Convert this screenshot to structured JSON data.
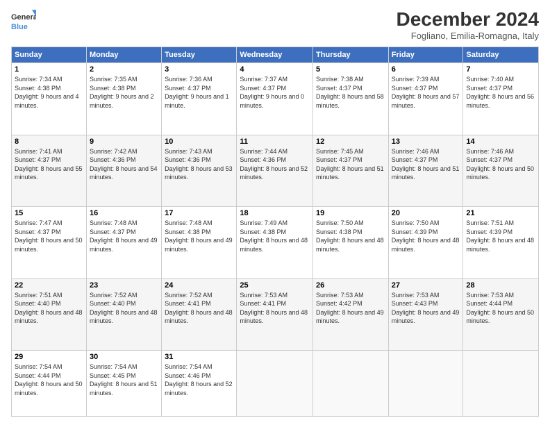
{
  "logo": {
    "line1": "General",
    "line2": "Blue"
  },
  "title": "December 2024",
  "subtitle": "Fogliano, Emilia-Romagna, Italy",
  "days_header": [
    "Sunday",
    "Monday",
    "Tuesday",
    "Wednesday",
    "Thursday",
    "Friday",
    "Saturday"
  ],
  "weeks": [
    [
      {
        "num": "1",
        "sunrise": "7:34 AM",
        "sunset": "4:38 PM",
        "daylight": "9 hours and 4 minutes."
      },
      {
        "num": "2",
        "sunrise": "7:35 AM",
        "sunset": "4:38 PM",
        "daylight": "9 hours and 2 minutes."
      },
      {
        "num": "3",
        "sunrise": "7:36 AM",
        "sunset": "4:37 PM",
        "daylight": "9 hours and 1 minute."
      },
      {
        "num": "4",
        "sunrise": "7:37 AM",
        "sunset": "4:37 PM",
        "daylight": "9 hours and 0 minutes."
      },
      {
        "num": "5",
        "sunrise": "7:38 AM",
        "sunset": "4:37 PM",
        "daylight": "8 hours and 58 minutes."
      },
      {
        "num": "6",
        "sunrise": "7:39 AM",
        "sunset": "4:37 PM",
        "daylight": "8 hours and 57 minutes."
      },
      {
        "num": "7",
        "sunrise": "7:40 AM",
        "sunset": "4:37 PM",
        "daylight": "8 hours and 56 minutes."
      }
    ],
    [
      {
        "num": "8",
        "sunrise": "7:41 AM",
        "sunset": "4:37 PM",
        "daylight": "8 hours and 55 minutes."
      },
      {
        "num": "9",
        "sunrise": "7:42 AM",
        "sunset": "4:36 PM",
        "daylight": "8 hours and 54 minutes."
      },
      {
        "num": "10",
        "sunrise": "7:43 AM",
        "sunset": "4:36 PM",
        "daylight": "8 hours and 53 minutes."
      },
      {
        "num": "11",
        "sunrise": "7:44 AM",
        "sunset": "4:36 PM",
        "daylight": "8 hours and 52 minutes."
      },
      {
        "num": "12",
        "sunrise": "7:45 AM",
        "sunset": "4:37 PM",
        "daylight": "8 hours and 51 minutes."
      },
      {
        "num": "13",
        "sunrise": "7:46 AM",
        "sunset": "4:37 PM",
        "daylight": "8 hours and 51 minutes."
      },
      {
        "num": "14",
        "sunrise": "7:46 AM",
        "sunset": "4:37 PM",
        "daylight": "8 hours and 50 minutes."
      }
    ],
    [
      {
        "num": "15",
        "sunrise": "7:47 AM",
        "sunset": "4:37 PM",
        "daylight": "8 hours and 50 minutes."
      },
      {
        "num": "16",
        "sunrise": "7:48 AM",
        "sunset": "4:37 PM",
        "daylight": "8 hours and 49 minutes."
      },
      {
        "num": "17",
        "sunrise": "7:48 AM",
        "sunset": "4:38 PM",
        "daylight": "8 hours and 49 minutes."
      },
      {
        "num": "18",
        "sunrise": "7:49 AM",
        "sunset": "4:38 PM",
        "daylight": "8 hours and 48 minutes."
      },
      {
        "num": "19",
        "sunrise": "7:50 AM",
        "sunset": "4:38 PM",
        "daylight": "8 hours and 48 minutes."
      },
      {
        "num": "20",
        "sunrise": "7:50 AM",
        "sunset": "4:39 PM",
        "daylight": "8 hours and 48 minutes."
      },
      {
        "num": "21",
        "sunrise": "7:51 AM",
        "sunset": "4:39 PM",
        "daylight": "8 hours and 48 minutes."
      }
    ],
    [
      {
        "num": "22",
        "sunrise": "7:51 AM",
        "sunset": "4:40 PM",
        "daylight": "8 hours and 48 minutes."
      },
      {
        "num": "23",
        "sunrise": "7:52 AM",
        "sunset": "4:40 PM",
        "daylight": "8 hours and 48 minutes."
      },
      {
        "num": "24",
        "sunrise": "7:52 AM",
        "sunset": "4:41 PM",
        "daylight": "8 hours and 48 minutes."
      },
      {
        "num": "25",
        "sunrise": "7:53 AM",
        "sunset": "4:41 PM",
        "daylight": "8 hours and 48 minutes."
      },
      {
        "num": "26",
        "sunrise": "7:53 AM",
        "sunset": "4:42 PM",
        "daylight": "8 hours and 49 minutes."
      },
      {
        "num": "27",
        "sunrise": "7:53 AM",
        "sunset": "4:43 PM",
        "daylight": "8 hours and 49 minutes."
      },
      {
        "num": "28",
        "sunrise": "7:53 AM",
        "sunset": "4:44 PM",
        "daylight": "8 hours and 50 minutes."
      }
    ],
    [
      {
        "num": "29",
        "sunrise": "7:54 AM",
        "sunset": "4:44 PM",
        "daylight": "8 hours and 50 minutes."
      },
      {
        "num": "30",
        "sunrise": "7:54 AM",
        "sunset": "4:45 PM",
        "daylight": "8 hours and 51 minutes."
      },
      {
        "num": "31",
        "sunrise": "7:54 AM",
        "sunset": "4:46 PM",
        "daylight": "8 hours and 52 minutes."
      },
      null,
      null,
      null,
      null
    ]
  ],
  "labels": {
    "sunrise": "Sunrise: ",
    "sunset": "Sunset: ",
    "daylight": "Daylight: "
  }
}
